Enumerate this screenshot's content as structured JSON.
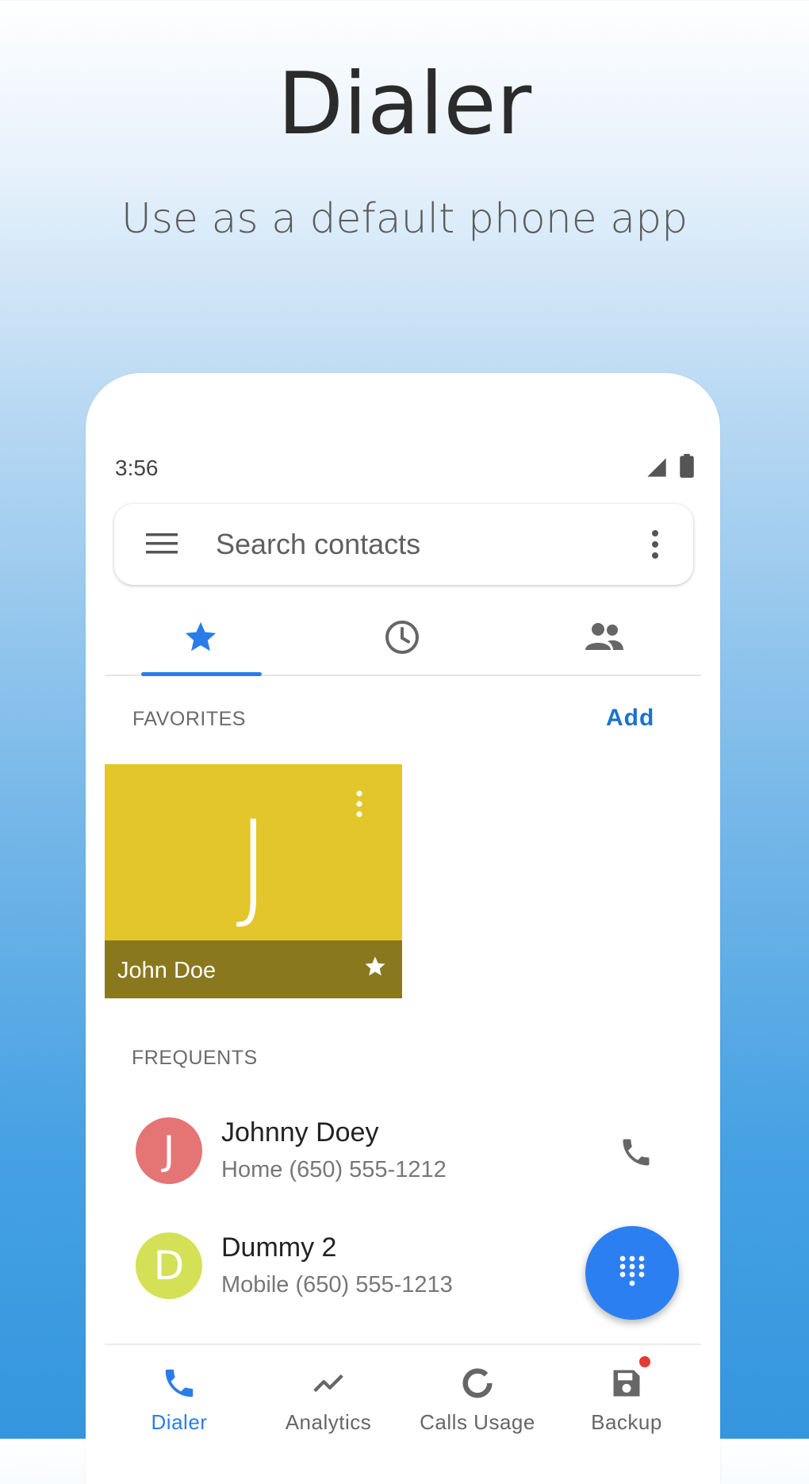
{
  "promo": {
    "title": "Dialer",
    "subtitle": "Use as a default phone app"
  },
  "status_bar": {
    "time": "3:56",
    "icons": [
      "signal-icon",
      "battery-icon"
    ]
  },
  "search": {
    "placeholder": "Search contacts",
    "icons": [
      "menu-icon",
      "more-vert-icon"
    ]
  },
  "tabs": [
    {
      "icon": "star-icon",
      "selected": true
    },
    {
      "icon": "clock-icon",
      "selected": false
    },
    {
      "icon": "people-icon",
      "selected": false
    }
  ],
  "favorites": {
    "label": "FAVORITES",
    "add_label": "Add",
    "cards": [
      {
        "initial": "J",
        "name": "John Doe",
        "color": "#e2c62b",
        "footer_color": "#8a781e",
        "starred": true
      }
    ]
  },
  "frequents": {
    "label": "FREQUENTS",
    "items": [
      {
        "initial": "J",
        "name": "Johnny Doey",
        "detail": "Home (650) 555-1212",
        "color": "#e57474"
      },
      {
        "initial": "D",
        "name": "Dummy 2",
        "detail": "Mobile (650) 555-1213",
        "color": "#d4e157"
      }
    ]
  },
  "fab": {
    "icon": "dialpad-icon",
    "color": "#2c7ff1"
  },
  "bottom_nav": [
    {
      "label": "Dialer",
      "icon": "phone-icon",
      "active": true
    },
    {
      "label": "Analytics",
      "icon": "trending-icon",
      "active": false
    },
    {
      "label": "Calls Usage",
      "icon": "donut-icon",
      "active": false
    },
    {
      "label": "Backup",
      "icon": "save-icon",
      "active": false,
      "badge": true
    }
  ],
  "colors": {
    "accent": "#2a7de8",
    "link": "#1a73c9",
    "badge": "#e53935"
  }
}
